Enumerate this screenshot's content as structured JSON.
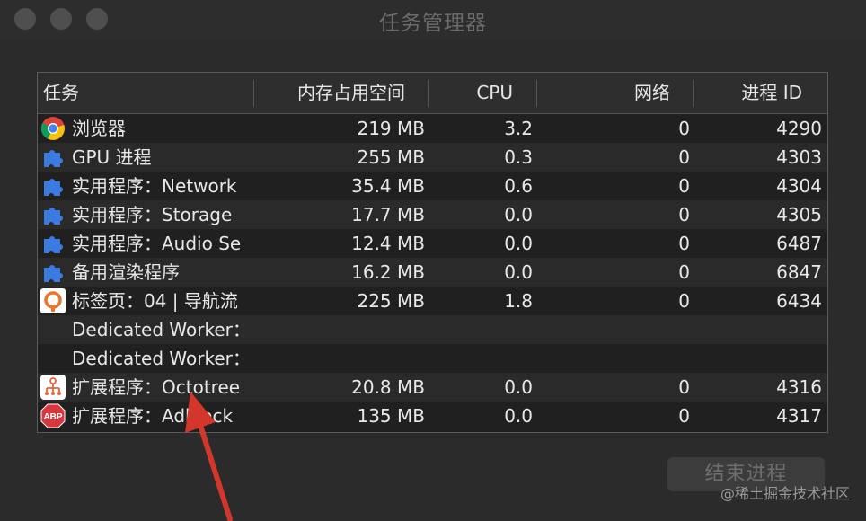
{
  "window": {
    "title": "任务管理器"
  },
  "columns": {
    "task": "任务",
    "memory": "内存占用空间",
    "cpu": "CPU",
    "network": "网络",
    "pid": "进程 ID"
  },
  "rows": [
    {
      "icon": "chrome-icon",
      "name": "浏览器",
      "memory": "219 MB",
      "cpu": "3.2",
      "network": "0",
      "pid": "4290"
    },
    {
      "icon": "puzzle-icon",
      "name": "GPU 进程",
      "memory": "255 MB",
      "cpu": "0.3",
      "network": "0",
      "pid": "4303"
    },
    {
      "icon": "puzzle-icon",
      "name": "实用程序：Network",
      "memory": "35.4 MB",
      "cpu": "0.6",
      "network": "0",
      "pid": "4304"
    },
    {
      "icon": "puzzle-icon",
      "name": "实用程序：Storage",
      "memory": "17.7 MB",
      "cpu": "0.0",
      "network": "0",
      "pid": "4305"
    },
    {
      "icon": "puzzle-icon",
      "name": "实用程序：Audio Se",
      "memory": "12.4 MB",
      "cpu": "0.0",
      "network": "0",
      "pid": "6487"
    },
    {
      "icon": "puzzle-icon",
      "name": "备用渲染程序",
      "memory": "16.2 MB",
      "cpu": "0.0",
      "network": "0",
      "pid": "6847"
    },
    {
      "icon": "orange-logo-icon",
      "name": "标签页：04 | 导航流",
      "memory": "225 MB",
      "cpu": "1.8",
      "network": "0",
      "pid": "6434"
    },
    {
      "icon": "",
      "name": "Dedicated Worker：",
      "memory": "",
      "cpu": "",
      "network": "",
      "pid": ""
    },
    {
      "icon": "",
      "name": "Dedicated Worker：",
      "memory": "",
      "cpu": "",
      "network": "",
      "pid": ""
    },
    {
      "icon": "octotree-icon",
      "name": "扩展程序：Octotree",
      "memory": "20.8 MB",
      "cpu": "0.0",
      "network": "0",
      "pid": "4316"
    },
    {
      "icon": "abp-icon",
      "name": "扩展程序：Adblock",
      "memory": "135 MB",
      "cpu": "0.0",
      "network": "0",
      "pid": "4317"
    }
  ],
  "footer": {
    "end_process_label": "结束进程"
  },
  "watermark": "@稀土掘金技术社区",
  "colors": {
    "window_bg": "#2b2b2b",
    "puzzle_blue": "#3d7ae0",
    "arrow_red": "#d3362b",
    "abp_red": "#d9363e"
  }
}
